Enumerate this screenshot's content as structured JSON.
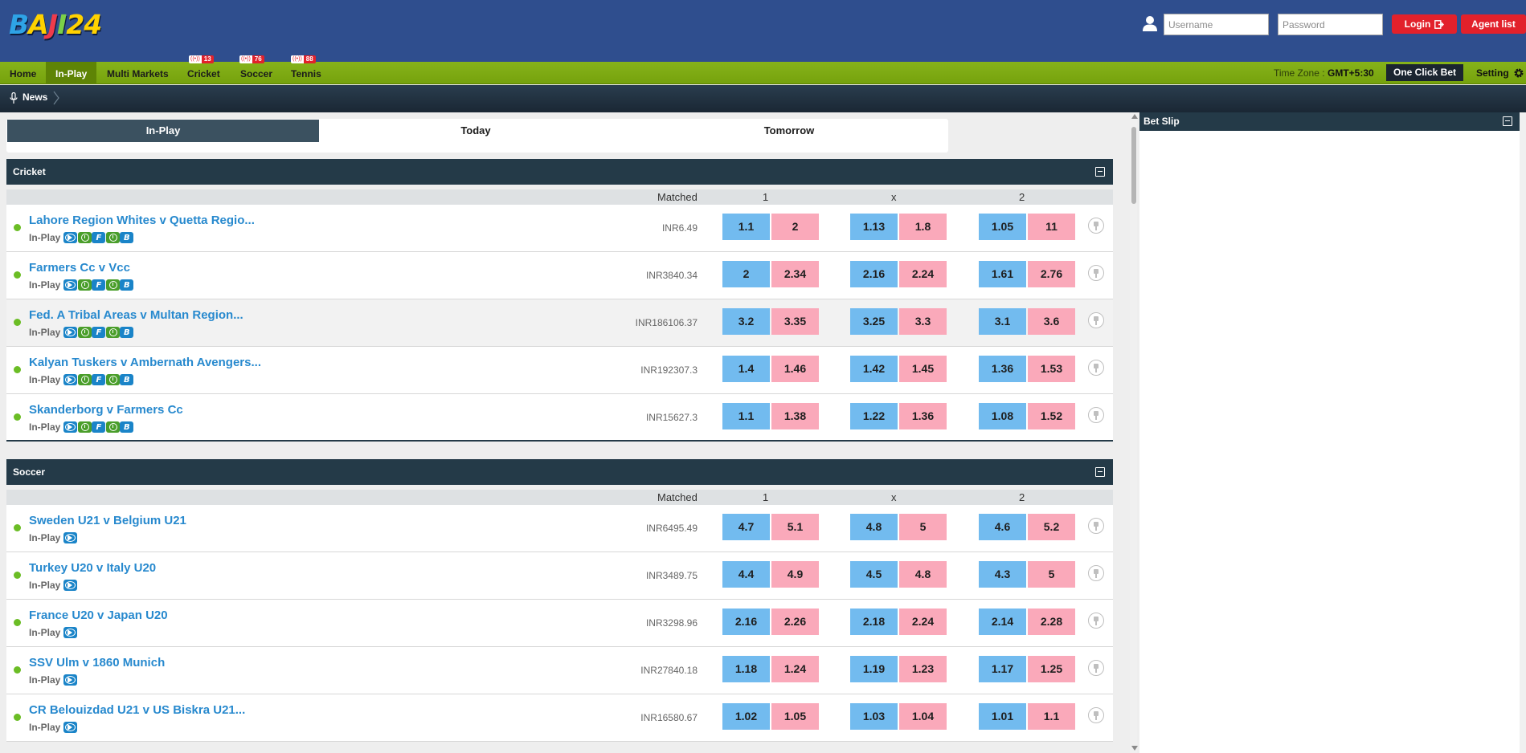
{
  "brand": {
    "logo_letters": [
      "B",
      "A",
      "J",
      "I",
      "2",
      "4"
    ]
  },
  "login": {
    "username_placeholder": "Username",
    "password_placeholder": "Password",
    "login_label": "Login",
    "agent_label": "Agent list"
  },
  "nav": {
    "items": [
      {
        "label": "Home"
      },
      {
        "label": "In-Play"
      },
      {
        "label": "Multi Markets"
      },
      {
        "label": "Cricket",
        "badge_live": "((•))",
        "badge_count": "13"
      },
      {
        "label": "Soccer",
        "badge_live": "((•))",
        "badge_count": "76"
      },
      {
        "label": "Tennis",
        "badge_live": "((•))",
        "badge_count": "88"
      }
    ],
    "timezone_label": "Time Zone :",
    "timezone_value": "GMT+5:30",
    "one_click_label": "One Click Bet",
    "setting_label": "Setting"
  },
  "news": {
    "label": "News"
  },
  "tabs": [
    {
      "label": "In-Play"
    },
    {
      "label": "Today"
    },
    {
      "label": "Tomorrow"
    }
  ],
  "columns": {
    "matched": "Matched",
    "c1": "1",
    "cx": "x",
    "c2": "2"
  },
  "sections": [
    {
      "title": "Cricket",
      "events": [
        {
          "name": "Lahore Region Whites v Quetta Regio...",
          "status": "In-Play",
          "matched": "INR6.49",
          "odds": [
            "1.1",
            "2",
            "1.13",
            "1.8",
            "1.05",
            "11"
          ]
        },
        {
          "name": "Farmers Cc v Vcc",
          "status": "In-Play",
          "matched": "INR3840.34",
          "odds": [
            "2",
            "2.34",
            "2.16",
            "2.24",
            "1.61",
            "2.76"
          ]
        },
        {
          "name": "Fed. A Tribal Areas v Multan Region...",
          "status": "In-Play",
          "matched": "INR186106.37",
          "odds": [
            "3.2",
            "3.35",
            "3.25",
            "3.3",
            "3.1",
            "3.6"
          ]
        },
        {
          "name": "Kalyan Tuskers v Ambernath Avengers...",
          "status": "In-Play",
          "matched": "INR192307.3",
          "odds": [
            "1.4",
            "1.46",
            "1.42",
            "1.45",
            "1.36",
            "1.53"
          ]
        },
        {
          "name": "Skanderborg v Farmers Cc",
          "status": "In-Play",
          "matched": "INR15627.3",
          "odds": [
            "1.1",
            "1.38",
            "1.22",
            "1.36",
            "1.08",
            "1.52"
          ]
        }
      ]
    },
    {
      "title": "Soccer",
      "events": [
        {
          "name": "Sweden U21 v Belgium U21",
          "status": "In-Play",
          "matched": "INR6495.49",
          "odds": [
            "4.7",
            "5.1",
            "4.8",
            "5",
            "4.6",
            "5.2"
          ]
        },
        {
          "name": "Turkey U20 v Italy U20",
          "status": "In-Play",
          "matched": "INR3489.75",
          "odds": [
            "4.4",
            "4.9",
            "4.5",
            "4.8",
            "4.3",
            "5"
          ]
        },
        {
          "name": "France U20 v Japan U20",
          "status": "In-Play",
          "matched": "INR3298.96",
          "odds": [
            "2.16",
            "2.26",
            "2.18",
            "2.24",
            "2.14",
            "2.28"
          ]
        },
        {
          "name": "SSV Ulm v 1860 Munich",
          "status": "In-Play",
          "matched": "INR27840.18",
          "odds": [
            "1.18",
            "1.24",
            "1.19",
            "1.23",
            "1.17",
            "1.25"
          ]
        },
        {
          "name": "CR Belouizdad U21 v US Biskra U21...",
          "status": "In-Play",
          "matched": "INR16580.67",
          "odds": [
            "1.02",
            "1.05",
            "1.03",
            "1.04",
            "1.01",
            "1.1"
          ]
        }
      ]
    }
  ],
  "betslip": {
    "title": "Bet Slip"
  }
}
